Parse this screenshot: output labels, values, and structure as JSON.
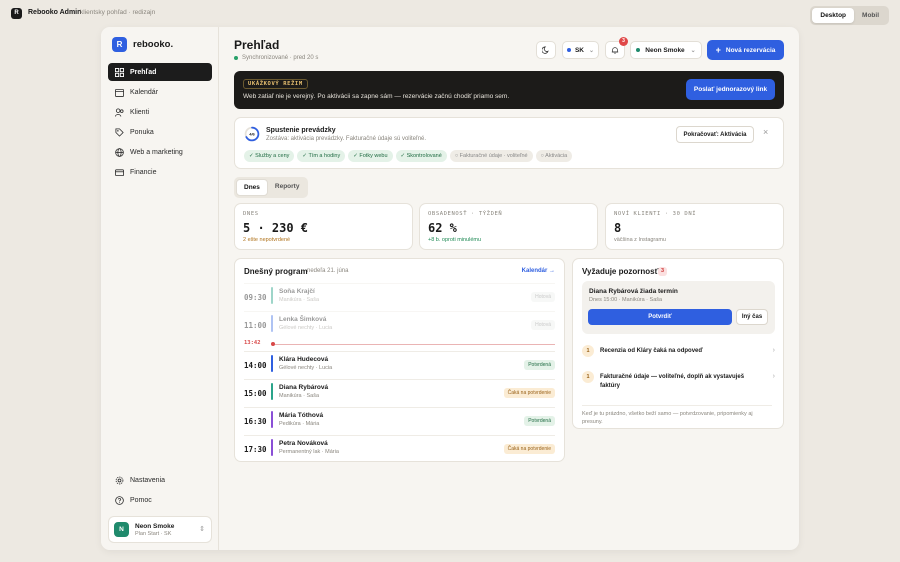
{
  "topbar": {
    "logo_letter": "R",
    "title": "Rebooko Admin",
    "subtitle": "klientsky pohľad · redizajn",
    "views": [
      "Desktop",
      "Mobil"
    ]
  },
  "sidebar": {
    "brand_letter": "R",
    "brand_name": "rebooko.",
    "items": [
      {
        "label": "Prehľad",
        "icon": "grid-icon"
      },
      {
        "label": "Kalendár",
        "icon": "calendar-icon"
      },
      {
        "label": "Klienti",
        "icon": "users-icon"
      },
      {
        "label": "Ponuka",
        "icon": "tag-icon"
      },
      {
        "label": "Web a marketing",
        "icon": "globe-icon"
      },
      {
        "label": "Financie",
        "icon": "card-icon"
      }
    ],
    "bottom": [
      {
        "label": "Nastavenia",
        "icon": "gear-icon"
      },
      {
        "label": "Pomoc",
        "icon": "help-icon"
      }
    ],
    "user": {
      "initial": "N",
      "name": "Neon Smoke",
      "plan": "Plan Start · SK"
    }
  },
  "header": {
    "title": "Prehľad",
    "sync": "Synchronizované · pred 20 s",
    "lang": "SK",
    "notif_count": "3",
    "studio": "Neon Smoke",
    "new_booking": "Nová rezervácia"
  },
  "demo": {
    "tag": "UKÁŽKOVÝ REŽIM",
    "message": "Web zatiaľ nie je verejný. Po aktivácii sa zapne sám — rezervácie začnú chodiť priamo sem.",
    "button": "Poslať jednorazový link"
  },
  "launch": {
    "ring": "4/6",
    "progress": 0.6667,
    "title": "Spustenie prevádzky",
    "subtitle": "Zostáva: aktivácia prevádzky. Fakturačné údaje sú voliteľné.",
    "continue": "Pokračovať: Aktivácia",
    "steps_done": [
      "Služby a ceny",
      "Tím a hodiny",
      "Fotky webu",
      "Skontrolované"
    ],
    "steps_todo": [
      "Fakturačné údaje · voliteľné",
      "Aktivácia"
    ]
  },
  "tabs": [
    "Dnes",
    "Reporty"
  ],
  "stats": [
    {
      "label": "DNES",
      "value": "5 · 230 €",
      "note": "2 ešte nepotvrdené",
      "note_color": "#b0731c"
    },
    {
      "label": "OBSADENOSŤ · TÝŽDEŇ",
      "value": "62 %",
      "note": "+8 b. oproti minulému",
      "note_color": "#1f8a55"
    },
    {
      "label": "NOVÍ KLIENTI · 30 DNÍ",
      "value": "8",
      "note": "väčšina z Instagramu",
      "note_color": "#8a867e"
    }
  ],
  "program": {
    "title": "Dnešný program",
    "date": "nedeľa 21. júna",
    "link": "Kalendár →",
    "now": "13:42",
    "rows": [
      {
        "time": "09:30",
        "name": "Soňa Krajčí",
        "service": "Manikúra · Saša",
        "status": "Hotová",
        "kind": "g",
        "color": "#2aa48a",
        "past": true
      },
      {
        "time": "11:00",
        "name": "Lenka Šimková",
        "service": "Gélové nechty · Lucia",
        "status": "Hotová",
        "kind": "g",
        "color": "#4f7be6",
        "past": true
      },
      {
        "time": "14:00",
        "name": "Klára Hudecová",
        "service": "Gélové nechty · Lucia",
        "status": "Potvrdená",
        "kind": "ok",
        "color": "#2f5fe0",
        "past": false
      },
      {
        "time": "15:00",
        "name": "Diana Rybárová",
        "service": "Manikúra · Saša",
        "status": "Čaká na potvrdenie",
        "kind": "wait",
        "color": "#2aa48a",
        "past": false
      },
      {
        "time": "16:30",
        "name": "Mária Tóthová",
        "service": "Pedikúra · Mária",
        "status": "Potvrdená",
        "kind": "ok",
        "color": "#8a4fd6",
        "past": false
      },
      {
        "time": "17:30",
        "name": "Petra Nováková",
        "service": "Permanentný lak · Mária",
        "status": "Čaká na potvrdenie",
        "kind": "wait",
        "color": "#8a4fd6",
        "past": false
      }
    ]
  },
  "attention": {
    "title": "Vyžaduje pozornosť",
    "count": "3",
    "request_title": "Diana Rybárová žiada termín",
    "request_sub": "Dnes 15:00 · Manikúra · Saša",
    "confirm": "Potvrdiť",
    "other": "Iný čas",
    "items": [
      {
        "num": "1",
        "text": "Recenzia od Kláry čaká na odpoveď"
      },
      {
        "num": "1",
        "text": "Fakturačné údaje — voliteľné, doplň ak vystavuješ faktúry"
      }
    ],
    "footer": "Keď je tu prázdno, všetko beží samo — potvrdzovanie, pripomienky aj presuny."
  }
}
